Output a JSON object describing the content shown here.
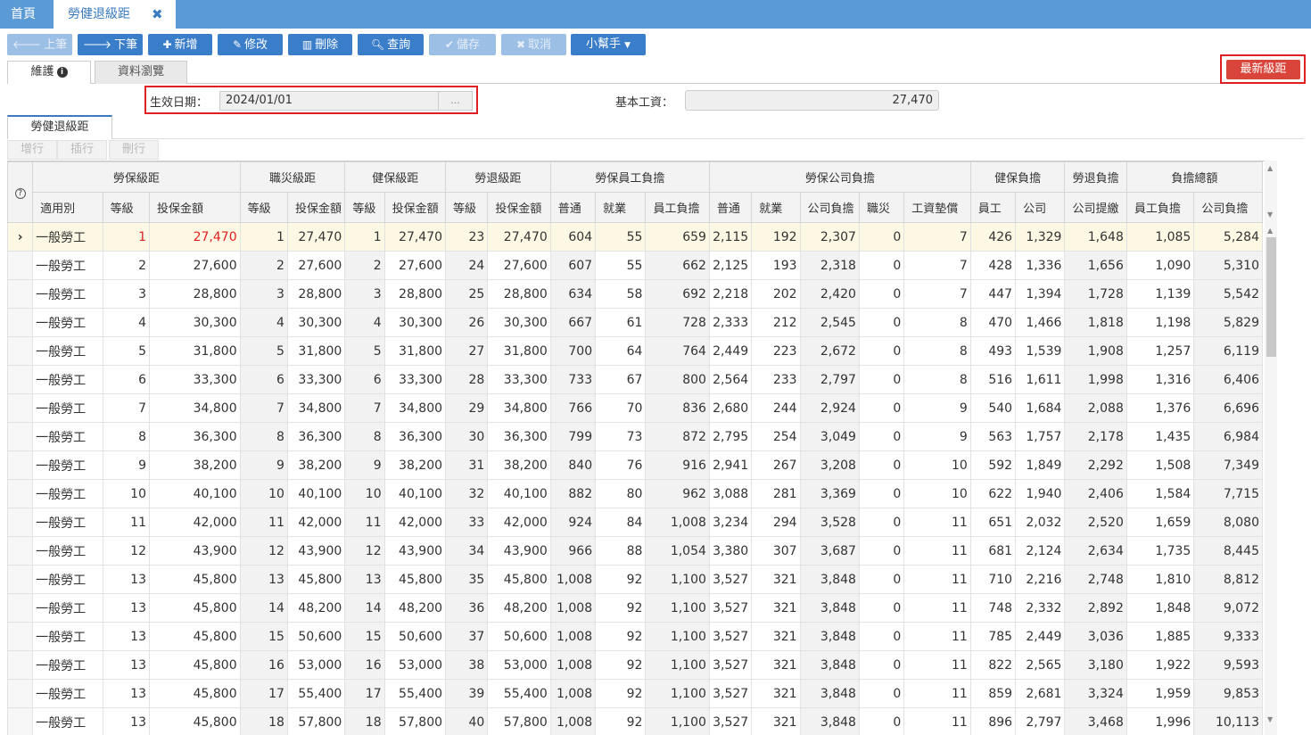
{
  "tabs": {
    "home": "首頁",
    "active": "勞健退級距"
  },
  "toolbar": {
    "prev": "上筆",
    "next": "下筆",
    "add": "新增",
    "edit": "修改",
    "delete": "刪除",
    "query": "查詢",
    "save": "儲存",
    "cancel": "取消",
    "helper": "小幫手"
  },
  "subtabs": {
    "maintain": "維護",
    "browse": "資料瀏覽"
  },
  "latest_button": "最新級距",
  "form": {
    "date_label": "生效日期：",
    "date_value": "2024/01/01",
    "date_btn": "...",
    "wage_label": "基本工資：",
    "wage_value": "27,470"
  },
  "grid_tab": "勞健退級距",
  "grid_buttons": {
    "add_row": "增行",
    "insert_row": "插行",
    "delete_row": "刪行"
  },
  "headers": {
    "help": "?",
    "group": [
      "勞保級距",
      "職災級距",
      "健保級距",
      "勞退級距",
      "勞保員工負擔",
      "勞保公司負擔",
      "健保負擔",
      "勞退負擔",
      "負擔總額"
    ],
    "sub": [
      "適用別",
      "等級",
      "投保金額",
      "等級",
      "投保金額",
      "等級",
      "投保金額",
      "等級",
      "投保金額",
      "普通",
      "就業",
      "員工負擔",
      "普通",
      "就業",
      "公司負擔",
      "職災",
      "工資墊償",
      "員工",
      "公司",
      "公司提繳",
      "員工負擔",
      "公司負擔"
    ]
  },
  "rows": [
    [
      "一般勞工",
      "1",
      "27,470",
      "1",
      "27,470",
      "1",
      "27,470",
      "23",
      "27,470",
      "604",
      "55",
      "659",
      "2,115",
      "192",
      "2,307",
      "0",
      "7",
      "426",
      "1,329",
      "1,648",
      "1,085",
      "5,284"
    ],
    [
      "一般勞工",
      "2",
      "27,600",
      "2",
      "27,600",
      "2",
      "27,600",
      "24",
      "27,600",
      "607",
      "55",
      "662",
      "2,125",
      "193",
      "2,318",
      "0",
      "7",
      "428",
      "1,336",
      "1,656",
      "1,090",
      "5,310"
    ],
    [
      "一般勞工",
      "3",
      "28,800",
      "3",
      "28,800",
      "3",
      "28,800",
      "25",
      "28,800",
      "634",
      "58",
      "692",
      "2,218",
      "202",
      "2,420",
      "0",
      "7",
      "447",
      "1,394",
      "1,728",
      "1,139",
      "5,542"
    ],
    [
      "一般勞工",
      "4",
      "30,300",
      "4",
      "30,300",
      "4",
      "30,300",
      "26",
      "30,300",
      "667",
      "61",
      "728",
      "2,333",
      "212",
      "2,545",
      "0",
      "8",
      "470",
      "1,466",
      "1,818",
      "1,198",
      "5,829"
    ],
    [
      "一般勞工",
      "5",
      "31,800",
      "5",
      "31,800",
      "5",
      "31,800",
      "27",
      "31,800",
      "700",
      "64",
      "764",
      "2,449",
      "223",
      "2,672",
      "0",
      "8",
      "493",
      "1,539",
      "1,908",
      "1,257",
      "6,119"
    ],
    [
      "一般勞工",
      "6",
      "33,300",
      "6",
      "33,300",
      "6",
      "33,300",
      "28",
      "33,300",
      "733",
      "67",
      "800",
      "2,564",
      "233",
      "2,797",
      "0",
      "8",
      "516",
      "1,611",
      "1,998",
      "1,316",
      "6,406"
    ],
    [
      "一般勞工",
      "7",
      "34,800",
      "7",
      "34,800",
      "7",
      "34,800",
      "29",
      "34,800",
      "766",
      "70",
      "836",
      "2,680",
      "244",
      "2,924",
      "0",
      "9",
      "540",
      "1,684",
      "2,088",
      "1,376",
      "6,696"
    ],
    [
      "一般勞工",
      "8",
      "36,300",
      "8",
      "36,300",
      "8",
      "36,300",
      "30",
      "36,300",
      "799",
      "73",
      "872",
      "2,795",
      "254",
      "3,049",
      "0",
      "9",
      "563",
      "1,757",
      "2,178",
      "1,435",
      "6,984"
    ],
    [
      "一般勞工",
      "9",
      "38,200",
      "9",
      "38,200",
      "9",
      "38,200",
      "31",
      "38,200",
      "840",
      "76",
      "916",
      "2,941",
      "267",
      "3,208",
      "0",
      "10",
      "592",
      "1,849",
      "2,292",
      "1,508",
      "7,349"
    ],
    [
      "一般勞工",
      "10",
      "40,100",
      "10",
      "40,100",
      "10",
      "40,100",
      "32",
      "40,100",
      "882",
      "80",
      "962",
      "3,088",
      "281",
      "3,369",
      "0",
      "10",
      "622",
      "1,940",
      "2,406",
      "1,584",
      "7,715"
    ],
    [
      "一般勞工",
      "11",
      "42,000",
      "11",
      "42,000",
      "11",
      "42,000",
      "33",
      "42,000",
      "924",
      "84",
      "1,008",
      "3,234",
      "294",
      "3,528",
      "0",
      "11",
      "651",
      "2,032",
      "2,520",
      "1,659",
      "8,080"
    ],
    [
      "一般勞工",
      "12",
      "43,900",
      "12",
      "43,900",
      "12",
      "43,900",
      "34",
      "43,900",
      "966",
      "88",
      "1,054",
      "3,380",
      "307",
      "3,687",
      "0",
      "11",
      "681",
      "2,124",
      "2,634",
      "1,735",
      "8,445"
    ],
    [
      "一般勞工",
      "13",
      "45,800",
      "13",
      "45,800",
      "13",
      "45,800",
      "35",
      "45,800",
      "1,008",
      "92",
      "1,100",
      "3,527",
      "321",
      "3,848",
      "0",
      "11",
      "710",
      "2,216",
      "2,748",
      "1,810",
      "8,812"
    ],
    [
      "一般勞工",
      "13",
      "45,800",
      "14",
      "48,200",
      "14",
      "48,200",
      "36",
      "48,200",
      "1,008",
      "92",
      "1,100",
      "3,527",
      "321",
      "3,848",
      "0",
      "11",
      "748",
      "2,332",
      "2,892",
      "1,848",
      "9,072"
    ],
    [
      "一般勞工",
      "13",
      "45,800",
      "15",
      "50,600",
      "15",
      "50,600",
      "37",
      "50,600",
      "1,008",
      "92",
      "1,100",
      "3,527",
      "321",
      "3,848",
      "0",
      "11",
      "785",
      "2,449",
      "3,036",
      "1,885",
      "9,333"
    ],
    [
      "一般勞工",
      "13",
      "45,800",
      "16",
      "53,000",
      "16",
      "53,000",
      "38",
      "53,000",
      "1,008",
      "92",
      "1,100",
      "3,527",
      "321",
      "3,848",
      "0",
      "11",
      "822",
      "2,565",
      "3,180",
      "1,922",
      "9,593"
    ],
    [
      "一般勞工",
      "13",
      "45,800",
      "17",
      "55,400",
      "17",
      "55,400",
      "39",
      "55,400",
      "1,008",
      "92",
      "1,100",
      "3,527",
      "321",
      "3,848",
      "0",
      "11",
      "859",
      "2,681",
      "3,324",
      "1,959",
      "9,853"
    ],
    [
      "一般勞工",
      "13",
      "45,800",
      "18",
      "57,800",
      "18",
      "57,800",
      "40",
      "57,800",
      "1,008",
      "92",
      "1,100",
      "3,527",
      "321",
      "3,848",
      "0",
      "11",
      "896",
      "2,797",
      "3,468",
      "1,996",
      "10,113"
    ]
  ],
  "colors": {
    "topbar": "#5b9bd5",
    "button": "#3a7dc9",
    "highlight": "#e02020",
    "selected_row": "#fcf8e3"
  },
  "icons": [
    "arrow-left-icon",
    "arrow-right-icon",
    "plus-icon",
    "pencil-icon",
    "trash-icon",
    "search-icon",
    "check-icon",
    "close-icon",
    "caret-down-icon",
    "info-icon",
    "help-icon",
    "row-pointer-icon"
  ]
}
